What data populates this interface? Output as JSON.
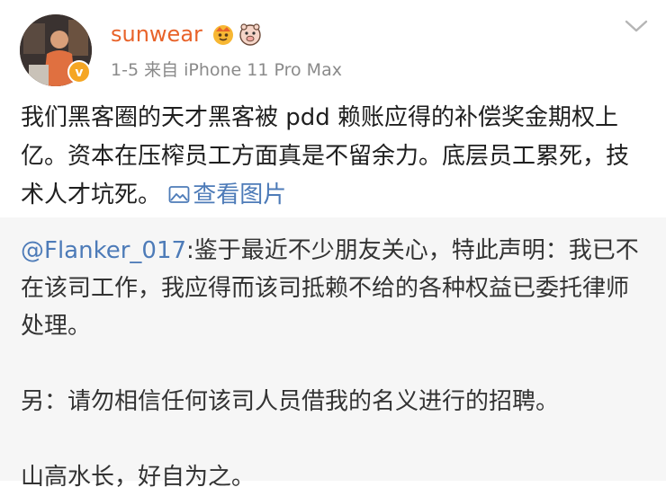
{
  "post": {
    "username": "sunwear",
    "meta": "1-5  来自 iPhone 11 Pro Max",
    "text": "我们黑客圈的天才黑客被 pdd 赖账应得的补偿奖金期权上亿。资本在压榨员工方面真是不留余力。底层员工累死，技术人才坑死。",
    "view_image_label": "查看图片"
  },
  "repost": {
    "mention": "@Flanker_017",
    "paragraph1": ":鉴于最近不少朋友关心，特此声明：我已不在该司工作，我应得而该司抵赖不给的各种权益已委托律师处理。",
    "paragraph2": "另：请勿相信任何该司人员借我的名义进行的招聘。",
    "paragraph3": "山高水长，好自为之。"
  },
  "colors": {
    "username": "#e8632a",
    "link": "#4d7bb8",
    "meta": "#8a8a8a",
    "repost_bg": "#f6f6f6",
    "verified_badge": "#f5a623"
  },
  "icons": [
    "verified-badge-icon",
    "crown-badge-icon",
    "pig-face-badge-icon",
    "chevron-down-icon",
    "image-icon"
  ]
}
